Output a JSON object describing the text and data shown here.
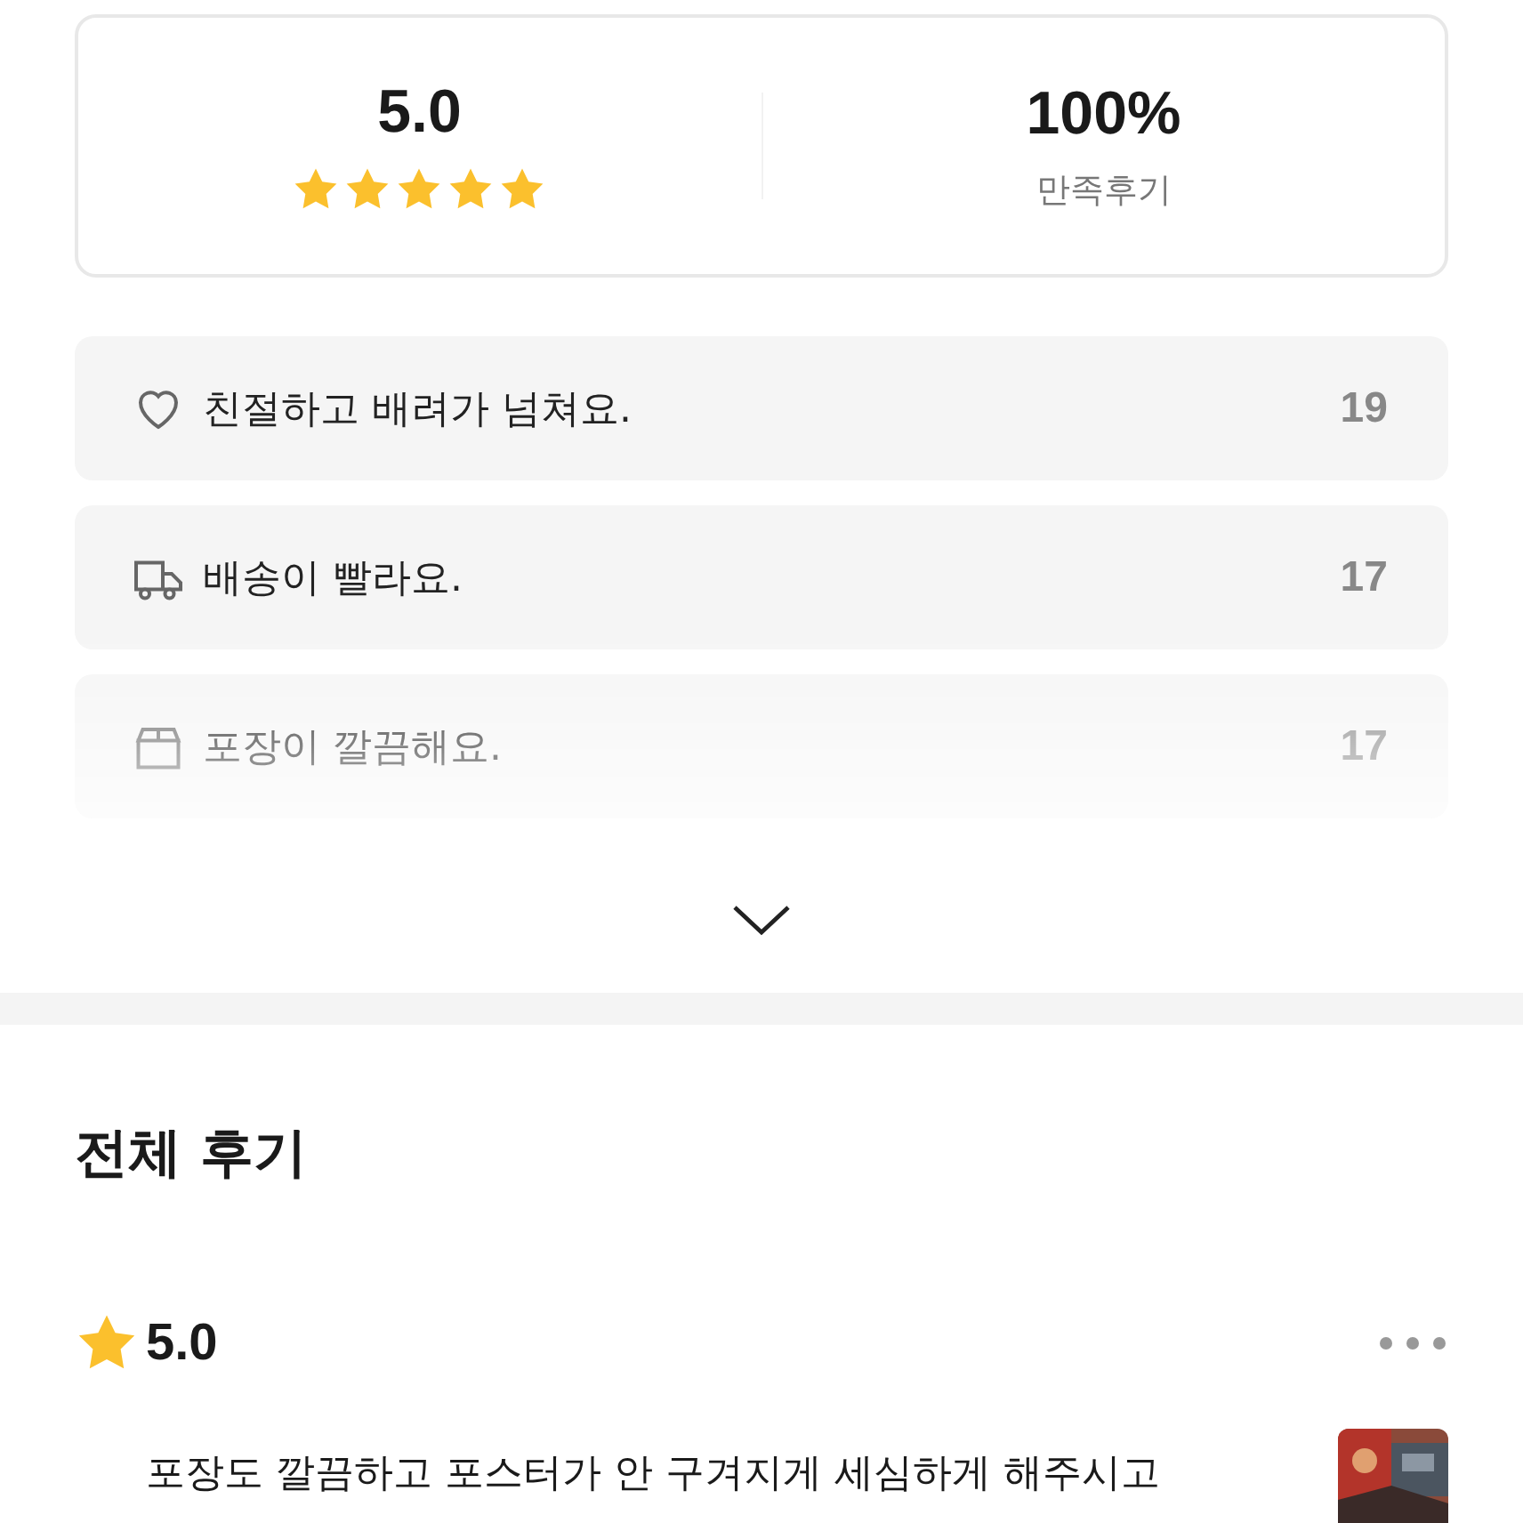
{
  "summary": {
    "score": "5.0",
    "stars": 5,
    "satisfaction": "100%",
    "satisfaction_label": "만족후기"
  },
  "keywords": {
    "collapsed": true,
    "items": [
      {
        "label": "친절하고 배려가 넘쳐요.",
        "count": "19"
      },
      {
        "label": "배송이 빨라요.",
        "count": "17"
      },
      {
        "label": "포장이 깔끔해요.",
        "count": "17"
      }
    ]
  },
  "all_reviews": {
    "title": "전체 후기",
    "reviews": [
      {
        "score": "5.0",
        "text": "포장도 깔끔하고 포스터가 안 구겨지게 세심하게 해주시고"
      }
    ]
  }
}
